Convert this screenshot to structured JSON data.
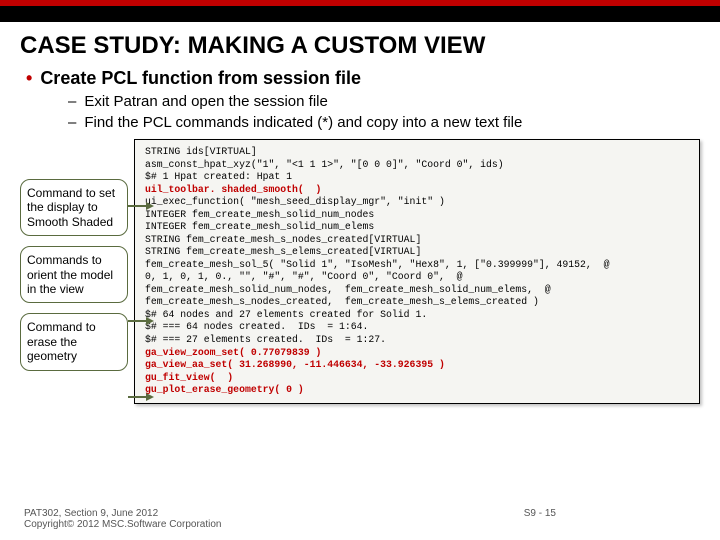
{
  "title": "CASE STUDY: MAKING A CUSTOM VIEW",
  "bullet": {
    "dot": "•",
    "text": "Create PCL function from session file"
  },
  "sub1": {
    "dash": "–",
    "text": "Exit Patran and open the session file"
  },
  "sub2": {
    "dash": "–",
    "text": "Find the PCL commands indicated (*) and copy into a new text file"
  },
  "callouts": {
    "c1": "Command to set the display to Smooth Shaded",
    "c2": "Commands to orient the model in the view",
    "c3": "Command to erase the geometry"
  },
  "code": {
    "l01": "STRING ids[VIRTUAL]",
    "l02": "asm_const_hpat_xyz(\"1\", \"<1 1 1>\", \"[0 0 0]\", \"Coord 0\", ids)",
    "l03": "$# 1 Hpat created: Hpat 1",
    "l04": "uil_toolbar. shaded_smooth(  )",
    "l05": "ui_exec_function( \"mesh_seed_display_mgr\", \"init\" )",
    "l06": "INTEGER fem_create_mesh_solid_num_nodes",
    "l07": "INTEGER fem_create_mesh_solid_num_elems",
    "l08": "STRING fem_create_mesh_s_nodes_created[VIRTUAL]",
    "l09": "STRING fem_create_mesh_s_elems_created[VIRTUAL]",
    "l10": "fem_create_mesh_sol_5( \"Solid 1\", \"IsoMesh\", \"Hex8\", 1, [\"0.399999\"], 49152,  @",
    "l11": "0, 1, 0, 1, 0., \"\", \"#\", \"#\", \"Coord 0\", \"Coord 0\",  @",
    "l12": "fem_create_mesh_solid_num_nodes,  fem_create_mesh_solid_num_elems,  @",
    "l13": "fem_create_mesh_s_nodes_created,  fem_create_mesh_s_elems_created )",
    "l14": "$# 64 nodes and 27 elements created for Solid 1.",
    "l15": "$# === 64 nodes created.  IDs  = 1:64.",
    "l16": "$# === 27 elements created.  IDs  = 1:27.",
    "l17": "ga_view_zoom_set( 0.77079839 )",
    "l18": "ga_view_aa_set( 31.268990, -11.446634, -33.926395 )",
    "l19": "gu_fit_view(  )",
    "l20": "gu_plot_erase_geometry( 0 )"
  },
  "footer": {
    "left1": "PAT302, Section 9, June 2012",
    "left2": "Copyright© 2012 MSC.Software Corporation",
    "page": "S9 - 15"
  }
}
